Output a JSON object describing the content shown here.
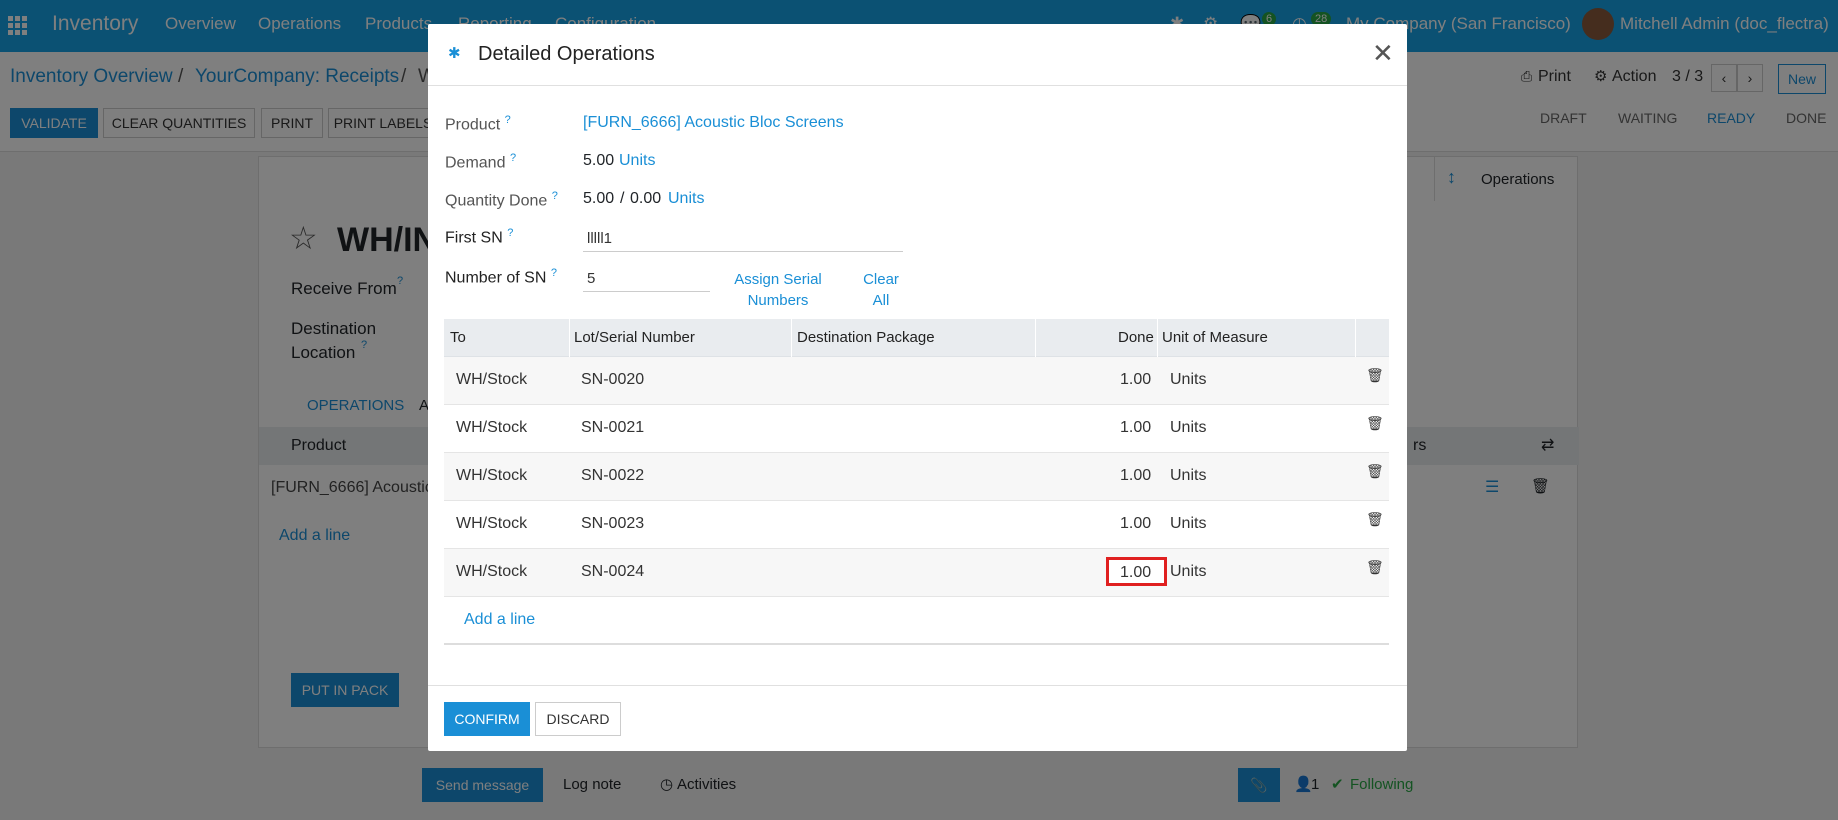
{
  "topnav": {
    "app_title": "Inventory",
    "menu": [
      "Overview",
      "Operations",
      "Products",
      "Reporting",
      "Configuration"
    ],
    "chat_count": "6",
    "activity_count": "28",
    "company": "My Company (San Francisco)",
    "user": "Mitchell Admin (doc_flectra)"
  },
  "breadcrumb": {
    "items": [
      "Inventory Overview",
      "YourCompany: Receipts",
      "W"
    ],
    "separator": "/"
  },
  "controls": {
    "print": "Print",
    "action": "Action",
    "pager": "3 / 3",
    "new": "New"
  },
  "action_buttons": [
    "VALIDATE",
    "CLEAR QUANTITIES",
    "PRINT",
    "PRINT LABELS"
  ],
  "stages": [
    "DRAFT",
    "WAITING",
    "READY",
    "DONE"
  ],
  "stage_active": "READY",
  "form": {
    "record_title": "WH/IN",
    "receive_from_label": "Receive From",
    "dest_location_label_1": "Destination",
    "dest_location_label_2": "Location",
    "operations_button": "Operations",
    "tab_operations": "OPERATIONS",
    "tab_next": "A",
    "col_product": "Product",
    "col_right": "rs",
    "product_line": "[FURN_6666] Acoustic",
    "add_line": "Add a line",
    "put_in_pack": "PUT IN PACK"
  },
  "chatter": {
    "send_message": "Send message",
    "log_note": "Log note",
    "activities": "Activities",
    "followers": "1",
    "following": "Following"
  },
  "modal": {
    "title": "Detailed Operations",
    "product_label": "Product",
    "product_value": "[FURN_6666] Acoustic Bloc Screens",
    "demand_label": "Demand",
    "demand_value": "5.00",
    "demand_uom": "Units",
    "qty_done_label": "Quantity Done",
    "qty_done_value": "5.00",
    "qty_done_sep": "/",
    "qty_done_total": "0.00",
    "qty_done_uom": "Units",
    "first_sn_label": "First SN",
    "first_sn_value": "lllll1",
    "num_sn_label": "Number of SN",
    "num_sn_value": "5",
    "assign_serial_1": "Assign Serial",
    "assign_serial_2": "Numbers",
    "clear_all_1": "Clear",
    "clear_all_2": "All",
    "help_mark": "?",
    "columns": [
      "To",
      "Lot/Serial Number",
      "Destination Package",
      "Done",
      "Unit of Measure"
    ],
    "rows": [
      {
        "to": "WH/Stock",
        "lot": "SN-0020",
        "package": "",
        "done": "1.00",
        "uom": "Units"
      },
      {
        "to": "WH/Stock",
        "lot": "SN-0021",
        "package": "",
        "done": "1.00",
        "uom": "Units"
      },
      {
        "to": "WH/Stock",
        "lot": "SN-0022",
        "package": "",
        "done": "1.00",
        "uom": "Units"
      },
      {
        "to": "WH/Stock",
        "lot": "SN-0023",
        "package": "",
        "done": "1.00",
        "uom": "Units"
      },
      {
        "to": "WH/Stock",
        "lot": "SN-0024",
        "package": "",
        "done": "1.00",
        "uom": "Units"
      }
    ],
    "add_line": "Add a line",
    "confirm": "CONFIRM",
    "discard": "DISCARD"
  },
  "colors": {
    "brand": "#17a2e6",
    "link": "#1a8fd6",
    "primary_button": "#1a8fd6",
    "highlight_border": "#e02020"
  }
}
